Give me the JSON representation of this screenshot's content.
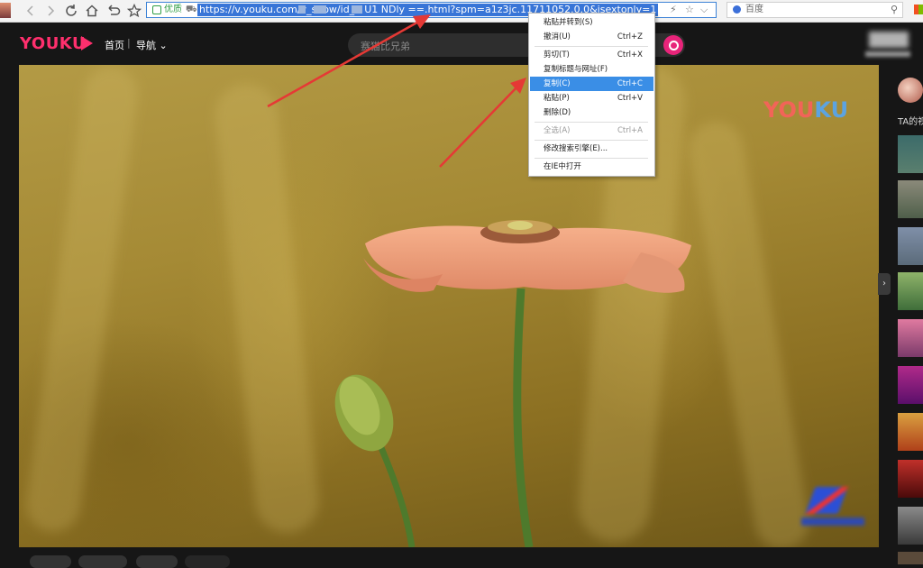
{
  "browser": {
    "address_bar": {
      "secure_label": "优质",
      "url": "https://v.youku.com/v_show/id_X  U1  NDly  ==.html?spm=a1z3jc.11711052.0.0&isextonly=1"
    },
    "search": {
      "placeholder": "百度"
    }
  },
  "youku": {
    "logo": "YOUKU",
    "nav": {
      "home": "首页",
      "separator": "|",
      "guide": "导航"
    },
    "search": {
      "placeholder": "赛猫比兄弟"
    }
  },
  "player": {
    "watermark_you": "YOU",
    "watermark_ku": "KU"
  },
  "sidebar": {
    "title": "TA的视"
  },
  "context_menu": {
    "items": [
      {
        "label": "粘贴并转到(S)",
        "shortcut": "",
        "state": "normal"
      },
      {
        "label": "撤消(U)",
        "shortcut": "Ctrl+Z",
        "state": "normal"
      },
      {
        "label": "剪切(T)",
        "shortcut": "Ctrl+X",
        "state": "normal"
      },
      {
        "label": "复制标题与网址(F)",
        "shortcut": "",
        "state": "normal"
      },
      {
        "label": "复制(C)",
        "shortcut": "Ctrl+C",
        "state": "highlighted"
      },
      {
        "label": "粘贴(P)",
        "shortcut": "Ctrl+V",
        "state": "normal"
      },
      {
        "label": "删除(D)",
        "shortcut": "",
        "state": "normal"
      },
      {
        "label": "全选(A)",
        "shortcut": "Ctrl+A",
        "state": "disabled"
      },
      {
        "label": "修改搜索引擎(E)...",
        "shortcut": "",
        "state": "normal"
      },
      {
        "label": "在IE中打开",
        "shortcut": "",
        "state": "normal"
      }
    ]
  },
  "colors": {
    "brand": "#ff2f6d",
    "menu_highlight": "#3a8ee6",
    "arrow": "#e53935",
    "url_selection": "#3875d7"
  }
}
